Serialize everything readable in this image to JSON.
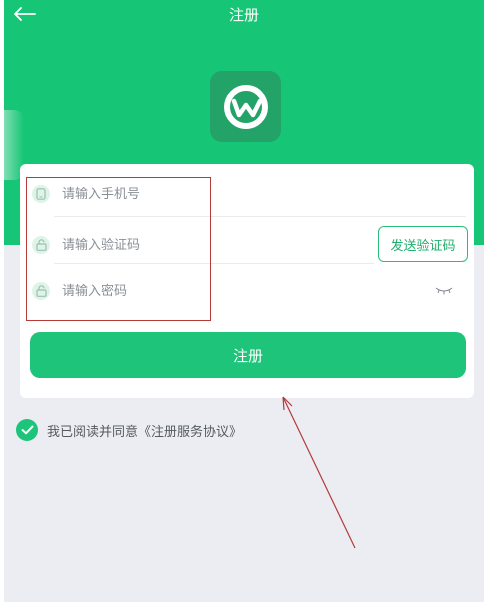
{
  "header": {
    "title": "注册",
    "back_icon": "arrow-left-icon",
    "background": "#16c575"
  },
  "logo": {
    "icon": "w-logo-icon"
  },
  "form": {
    "phone": {
      "placeholder": "请输入手机号",
      "icon": "phone-icon"
    },
    "code": {
      "placeholder": "请输入验证码",
      "icon": "lock-icon",
      "send_label": "发送验证码"
    },
    "password": {
      "placeholder": "请输入密码",
      "icon": "lock-icon",
      "toggle_icon": "eye-closed-icon"
    },
    "submit_label": "注册"
  },
  "agreement": {
    "checked": true,
    "text": "我已阅读并同意《注册服务协议》"
  },
  "colors": {
    "accent": "#1dc47a",
    "annotation": "#b53a3a"
  }
}
